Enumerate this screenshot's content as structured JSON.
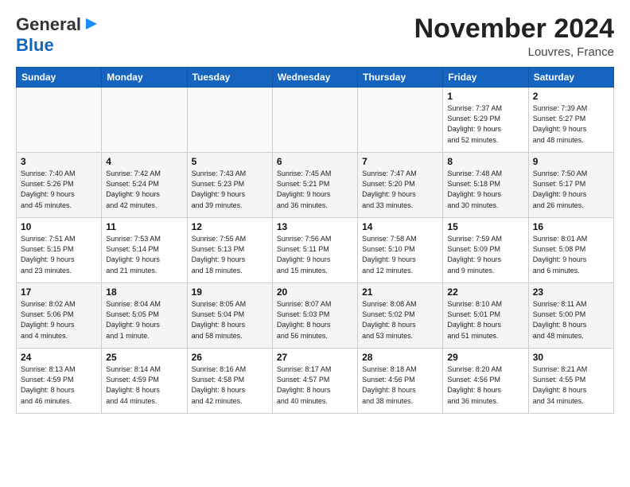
{
  "logo": {
    "line1": "General",
    "line2": "Blue",
    "arrow": "▶"
  },
  "header": {
    "title": "November 2024",
    "location": "Louvres, France"
  },
  "columns": [
    "Sunday",
    "Monday",
    "Tuesday",
    "Wednesday",
    "Thursday",
    "Friday",
    "Saturday"
  ],
  "weeks": [
    [
      {
        "day": "",
        "info": ""
      },
      {
        "day": "",
        "info": ""
      },
      {
        "day": "",
        "info": ""
      },
      {
        "day": "",
        "info": ""
      },
      {
        "day": "",
        "info": ""
      },
      {
        "day": "1",
        "info": "Sunrise: 7:37 AM\nSunset: 5:29 PM\nDaylight: 9 hours\nand 52 minutes."
      },
      {
        "day": "2",
        "info": "Sunrise: 7:39 AM\nSunset: 5:27 PM\nDaylight: 9 hours\nand 48 minutes."
      }
    ],
    [
      {
        "day": "3",
        "info": "Sunrise: 7:40 AM\nSunset: 5:26 PM\nDaylight: 9 hours\nand 45 minutes."
      },
      {
        "day": "4",
        "info": "Sunrise: 7:42 AM\nSunset: 5:24 PM\nDaylight: 9 hours\nand 42 minutes."
      },
      {
        "day": "5",
        "info": "Sunrise: 7:43 AM\nSunset: 5:23 PM\nDaylight: 9 hours\nand 39 minutes."
      },
      {
        "day": "6",
        "info": "Sunrise: 7:45 AM\nSunset: 5:21 PM\nDaylight: 9 hours\nand 36 minutes."
      },
      {
        "day": "7",
        "info": "Sunrise: 7:47 AM\nSunset: 5:20 PM\nDaylight: 9 hours\nand 33 minutes."
      },
      {
        "day": "8",
        "info": "Sunrise: 7:48 AM\nSunset: 5:18 PM\nDaylight: 9 hours\nand 30 minutes."
      },
      {
        "day": "9",
        "info": "Sunrise: 7:50 AM\nSunset: 5:17 PM\nDaylight: 9 hours\nand 26 minutes."
      }
    ],
    [
      {
        "day": "10",
        "info": "Sunrise: 7:51 AM\nSunset: 5:15 PM\nDaylight: 9 hours\nand 23 minutes."
      },
      {
        "day": "11",
        "info": "Sunrise: 7:53 AM\nSunset: 5:14 PM\nDaylight: 9 hours\nand 21 minutes."
      },
      {
        "day": "12",
        "info": "Sunrise: 7:55 AM\nSunset: 5:13 PM\nDaylight: 9 hours\nand 18 minutes."
      },
      {
        "day": "13",
        "info": "Sunrise: 7:56 AM\nSunset: 5:11 PM\nDaylight: 9 hours\nand 15 minutes."
      },
      {
        "day": "14",
        "info": "Sunrise: 7:58 AM\nSunset: 5:10 PM\nDaylight: 9 hours\nand 12 minutes."
      },
      {
        "day": "15",
        "info": "Sunrise: 7:59 AM\nSunset: 5:09 PM\nDaylight: 9 hours\nand 9 minutes."
      },
      {
        "day": "16",
        "info": "Sunrise: 8:01 AM\nSunset: 5:08 PM\nDaylight: 9 hours\nand 6 minutes."
      }
    ],
    [
      {
        "day": "17",
        "info": "Sunrise: 8:02 AM\nSunset: 5:06 PM\nDaylight: 9 hours\nand 4 minutes."
      },
      {
        "day": "18",
        "info": "Sunrise: 8:04 AM\nSunset: 5:05 PM\nDaylight: 9 hours\nand 1 minute."
      },
      {
        "day": "19",
        "info": "Sunrise: 8:05 AM\nSunset: 5:04 PM\nDaylight: 8 hours\nand 58 minutes."
      },
      {
        "day": "20",
        "info": "Sunrise: 8:07 AM\nSunset: 5:03 PM\nDaylight: 8 hours\nand 56 minutes."
      },
      {
        "day": "21",
        "info": "Sunrise: 8:08 AM\nSunset: 5:02 PM\nDaylight: 8 hours\nand 53 minutes."
      },
      {
        "day": "22",
        "info": "Sunrise: 8:10 AM\nSunset: 5:01 PM\nDaylight: 8 hours\nand 51 minutes."
      },
      {
        "day": "23",
        "info": "Sunrise: 8:11 AM\nSunset: 5:00 PM\nDaylight: 8 hours\nand 48 minutes."
      }
    ],
    [
      {
        "day": "24",
        "info": "Sunrise: 8:13 AM\nSunset: 4:59 PM\nDaylight: 8 hours\nand 46 minutes."
      },
      {
        "day": "25",
        "info": "Sunrise: 8:14 AM\nSunset: 4:59 PM\nDaylight: 8 hours\nand 44 minutes."
      },
      {
        "day": "26",
        "info": "Sunrise: 8:16 AM\nSunset: 4:58 PM\nDaylight: 8 hours\nand 42 minutes."
      },
      {
        "day": "27",
        "info": "Sunrise: 8:17 AM\nSunset: 4:57 PM\nDaylight: 8 hours\nand 40 minutes."
      },
      {
        "day": "28",
        "info": "Sunrise: 8:18 AM\nSunset: 4:56 PM\nDaylight: 8 hours\nand 38 minutes."
      },
      {
        "day": "29",
        "info": "Sunrise: 8:20 AM\nSunset: 4:56 PM\nDaylight: 8 hours\nand 36 minutes."
      },
      {
        "day": "30",
        "info": "Sunrise: 8:21 AM\nSunset: 4:55 PM\nDaylight: 8 hours\nand 34 minutes."
      }
    ]
  ]
}
